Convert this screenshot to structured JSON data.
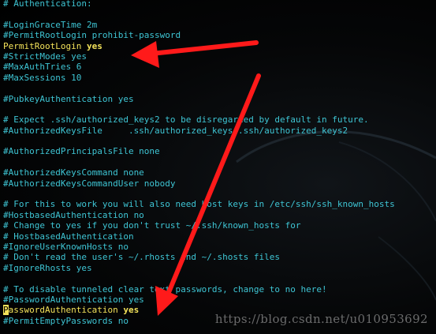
{
  "lines": [
    "# Authentication:",
    "",
    "#LoginGraceTime 2m",
    "#PermitRootLogin prohibit-password",
    "PermitRootLogin yes",
    "#StrictModes yes",
    "#MaxAuthTries 6",
    "#MaxSessions 10",
    "",
    "#PubkeyAuthentication yes",
    "",
    "# Expect .ssh/authorized_keys2 to be disregarded by default in future.",
    "#AuthorizedKeysFile     .ssh/authorized_keys .ssh/authorized_keys2",
    "",
    "#AuthorizedPrincipalsFile none",
    "",
    "#AuthorizedKeysCommand none",
    "#AuthorizedKeysCommandUser nobody",
    "",
    "# For this to work you will also need host keys in /etc/ssh/ssh_known_hosts",
    "#HostbasedAuthentication no",
    "# Change to yes if you don't trust ~/.ssh/known_hosts for",
    "# HostbasedAuthentication",
    "#IgnoreUserKnownHosts no",
    "# Don't read the user's ~/.rhosts and ~/.shosts files",
    "#IgnoreRhosts yes",
    "",
    "# To disable tunneled clear text passwords, change to no here!",
    "#PasswordAuthentication yes",
    "PasswordAuthentication yes",
    "#PermitEmptyPasswords no"
  ],
  "highlight_1": {
    "keyword": "PermitRootLogin",
    "value": "yes"
  },
  "highlight_2": {
    "cursor_char": "P",
    "keyword_rest": "asswordAuthentication",
    "value": "yes"
  },
  "watermark": "https://blog.csdn.net/u010953692",
  "colors": {
    "comment_text": "#3ec5d4",
    "active_text": "#f3e25a",
    "arrow": "#ff1a1a",
    "background": "#000000"
  }
}
